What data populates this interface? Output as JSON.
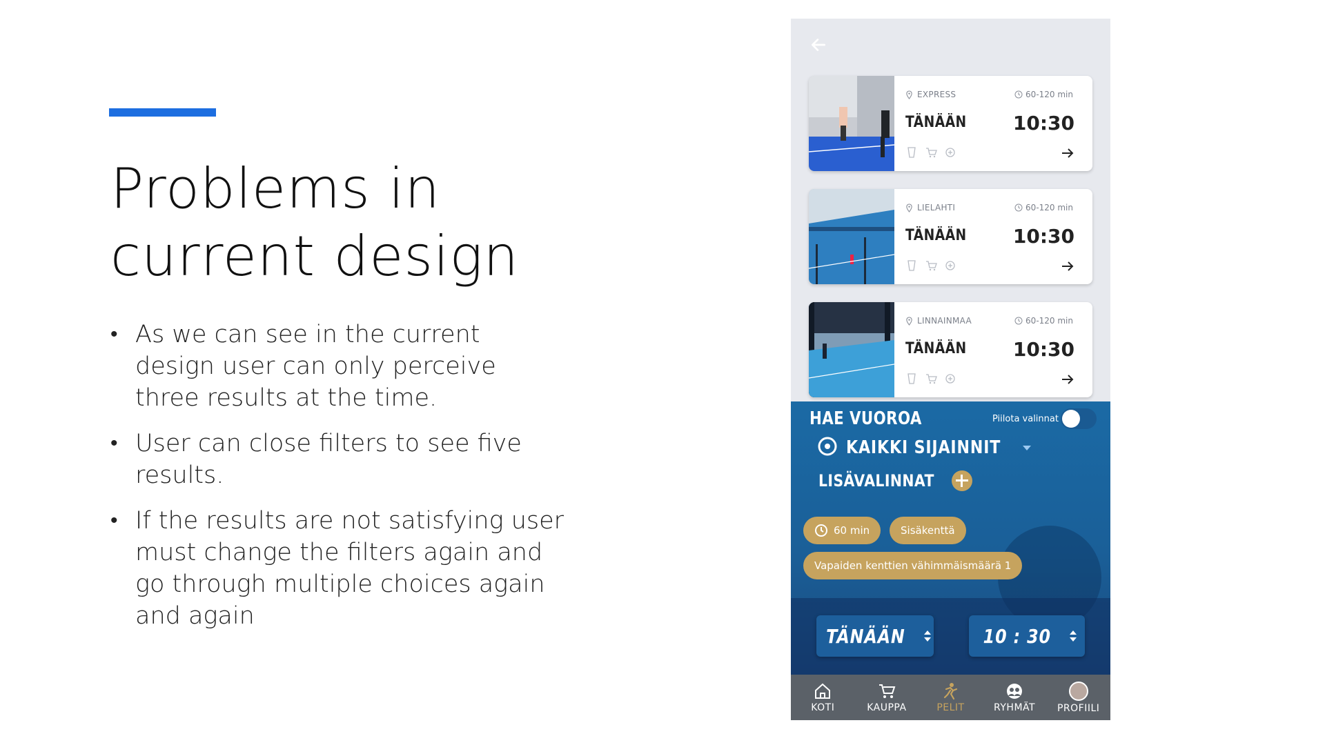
{
  "slide": {
    "title_line1": "Problems in",
    "title_line2": "current design",
    "bullets": [
      "As we can see in the current design user can only perceive three results at the time.",
      "User can close filters to see five results.",
      "If the results are not satisfying user must change the filters again and go through multiple choices again and again"
    ],
    "accent_color": "#1d6ee0"
  },
  "app": {
    "back_icon": "arrow-left-icon",
    "cards": [
      {
        "location": "EXPRESS",
        "duration": "60-120 min",
        "day": "TÄNÄÄN",
        "time": "10:30"
      },
      {
        "location": "LIELAHTI",
        "duration": "60-120 min",
        "day": "TÄNÄÄN",
        "time": "10:30"
      },
      {
        "location": "LINNAINMAA",
        "duration": "60-120 min",
        "day": "TÄNÄÄN",
        "time": "10:30"
      }
    ],
    "filter": {
      "title": "HAE VUOROA",
      "hide_label": "Piilota valinnat",
      "location_value": "KAIKKI SIJAINNIT",
      "more_label": "LISÄVALINNAT",
      "chips": [
        "60 min",
        "Sisäkenttä",
        "Vapaiden kenttien vähimmäismäärä 1"
      ],
      "date_value": "TÄNÄÄN",
      "time_value": "10 : 30"
    },
    "nav": [
      {
        "label": "KOTI",
        "icon": "home-icon"
      },
      {
        "label": "KAUPPA",
        "icon": "cart-icon"
      },
      {
        "label": "PELIT",
        "icon": "player-icon",
        "active": true
      },
      {
        "label": "RYHMÄT",
        "icon": "group-icon"
      },
      {
        "label": "PROFIILI",
        "icon": "avatar-icon"
      }
    ],
    "colors": {
      "panel_blue": "#1b6aa5",
      "gold": "#c6a35e",
      "nav_gray": "#5b6168"
    }
  }
}
